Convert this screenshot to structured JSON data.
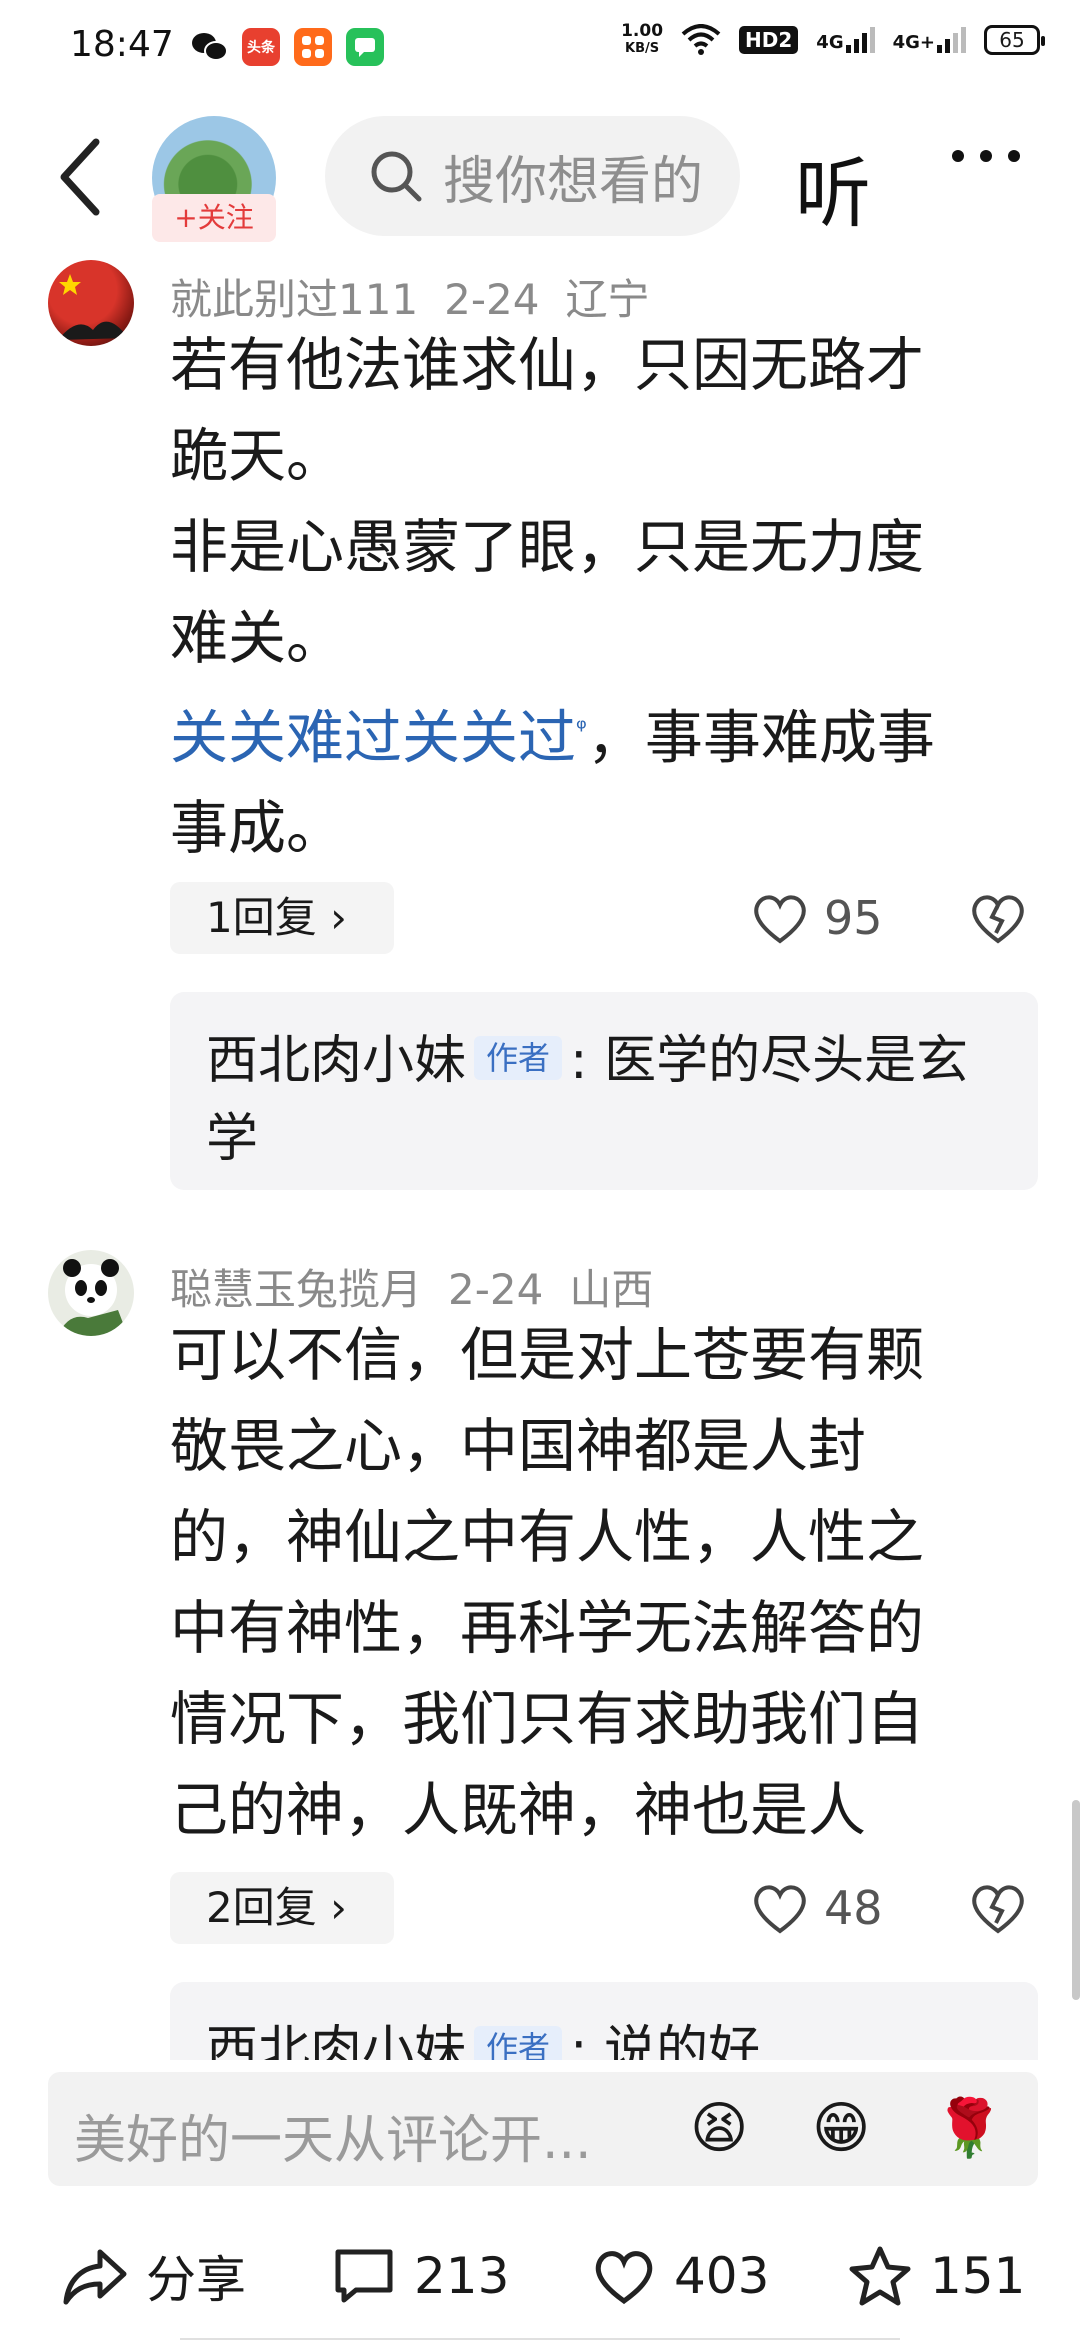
{
  "status_bar": {
    "time": "18:47",
    "app_icons": [
      "wechat-icon",
      "toutiao-icon",
      "taobao-icon",
      "messages-icon"
    ],
    "toutiao_label": "头条",
    "net_speed_value": "1.00",
    "net_speed_unit": "KB/S",
    "hd_label": "HD2",
    "signal1": "4G",
    "signal2": "4G+",
    "battery": "65"
  },
  "header": {
    "follow_label": "+关注",
    "search_placeholder": "搜你想看的",
    "listen_label": "听"
  },
  "comments": [
    {
      "user": "就此别过111",
      "date": "2-24",
      "region": "辽宁",
      "text_lines": [
        "若有他法谁求仙，只因无路才",
        "跪天。",
        "非是心愚蒙了眼，只是无力度",
        "难关。"
      ],
      "link_text": "关关难过关关过",
      "link_suffix": "，事事难成事",
      "last_line": "事成。",
      "reply_label": "1回复 ›",
      "likes": "95",
      "sub_reply": {
        "author": "西北肉小妹",
        "tag": "作者",
        "text": ": 医学的尽头是玄学"
      }
    },
    {
      "user": "聪慧玉兔揽月",
      "date": "2-24",
      "region": "山西",
      "text_lines": [
        "可以不信，但是对上苍要有颗",
        "敬畏之心，中国神都是人封",
        "的，神仙之中有人性，人性之",
        "中有神性，再科学无法解答的",
        "情况下，我们只有求助我们自",
        "己的神，人既神，神也是人"
      ],
      "reply_label": "2回复 ›",
      "likes": "48",
      "sub_reply": {
        "author": "西北肉小妹",
        "tag": "作者",
        "text": ": 说的好"
      }
    }
  ],
  "input": {
    "placeholder": "美好的一天从评论开...",
    "emojis": [
      "😫",
      "😁",
      "🌹"
    ]
  },
  "bottom_bar": {
    "share_label": "分享",
    "comments_count": "213",
    "likes_count": "403",
    "favorites_count": "151"
  }
}
